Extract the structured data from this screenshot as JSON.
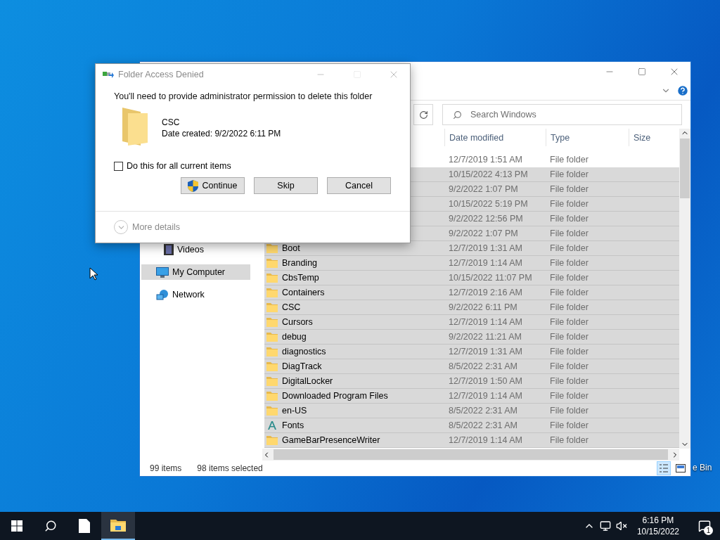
{
  "dialog": {
    "title": "Folder Access Denied",
    "message": "You'll need to provide administrator permission to delete this folder",
    "item": {
      "name": "CSC",
      "detail": "Date created: 9/2/2022 6:11 PM"
    },
    "checkbox": {
      "label": "Do this for all current items",
      "checked": false
    },
    "buttons": [
      {
        "label": "Continue",
        "kind": "shield"
      },
      {
        "label": "Skip",
        "kind": "plain"
      },
      {
        "label": "Cancel",
        "kind": "plain"
      }
    ],
    "more_details": "More details"
  },
  "explorer": {
    "search": {
      "placeholder": "Search Windows"
    },
    "columns": [
      "Date modified",
      "Type",
      "Size"
    ],
    "nav": [
      {
        "label": "Videos",
        "kind": "videos",
        "selected": false
      },
      {
        "label": "My Computer",
        "kind": "computer",
        "selected": true
      },
      {
        "label": "Network",
        "kind": "network",
        "selected": false
      }
    ],
    "rows": [
      {
        "modified": "12/7/2019 1:51 AM",
        "type": "File folder",
        "selected": false
      },
      {
        "modified": "10/15/2022 4:13 PM",
        "type": "File folder",
        "selected": true
      },
      {
        "modified": "9/2/2022 1:07 PM",
        "type": "File folder",
        "selected": true
      },
      {
        "modified": "10/15/2022 5:19 PM",
        "type": "File folder",
        "selected": true
      },
      {
        "modified": "9/2/2022 12:56 PM",
        "type": "File folder",
        "selected": true
      },
      {
        "modified": "9/2/2022 1:07 PM",
        "type": "File folder",
        "selected": true
      },
      {
        "name": "Boot",
        "kind": "folder",
        "modified": "12/7/2019 1:31 AM",
        "type": "File folder",
        "selected": true
      },
      {
        "name": "Branding",
        "kind": "folder",
        "modified": "12/7/2019 1:14 AM",
        "type": "File folder",
        "selected": true
      },
      {
        "name": "CbsTemp",
        "kind": "folder",
        "modified": "10/15/2022 11:07 PM",
        "type": "File folder",
        "selected": true
      },
      {
        "name": "Containers",
        "kind": "folder",
        "modified": "12/7/2019 2:16 AM",
        "type": "File folder",
        "selected": true
      },
      {
        "name": "CSC",
        "kind": "folder",
        "modified": "9/2/2022 6:11 PM",
        "type": "File folder",
        "selected": true
      },
      {
        "name": "Cursors",
        "kind": "folder",
        "modified": "12/7/2019 1:14 AM",
        "type": "File folder",
        "selected": true
      },
      {
        "name": "debug",
        "kind": "folder",
        "modified": "9/2/2022 11:21 AM",
        "type": "File folder",
        "selected": true
      },
      {
        "name": "diagnostics",
        "kind": "folder",
        "modified": "12/7/2019 1:31 AM",
        "type": "File folder",
        "selected": true
      },
      {
        "name": "DiagTrack",
        "kind": "folder",
        "modified": "8/5/2022 2:31 AM",
        "type": "File folder",
        "selected": true
      },
      {
        "name": "DigitalLocker",
        "kind": "folder",
        "modified": "12/7/2019 1:50 AM",
        "type": "File folder",
        "selected": true
      },
      {
        "name": "Downloaded Program Files",
        "kind": "folder",
        "modified": "12/7/2019 1:14 AM",
        "type": "File folder",
        "selected": true
      },
      {
        "name": "en-US",
        "kind": "folder",
        "modified": "8/5/2022 2:31 AM",
        "type": "File folder",
        "selected": true
      },
      {
        "name": "Fonts",
        "kind": "fonts",
        "modified": "8/5/2022 2:31 AM",
        "type": "File folder",
        "selected": true
      },
      {
        "name": "GameBarPresenceWriter",
        "kind": "folder",
        "modified": "12/7/2019 1:14 AM",
        "type": "File folder",
        "selected": true
      }
    ],
    "status": {
      "count": "99 items",
      "selection": "98 items selected"
    }
  },
  "desktop": {
    "icon_label": "e Bin"
  },
  "taskbar": {
    "time": "6:16 PM",
    "date": "10/15/2022",
    "notifications": "1"
  }
}
